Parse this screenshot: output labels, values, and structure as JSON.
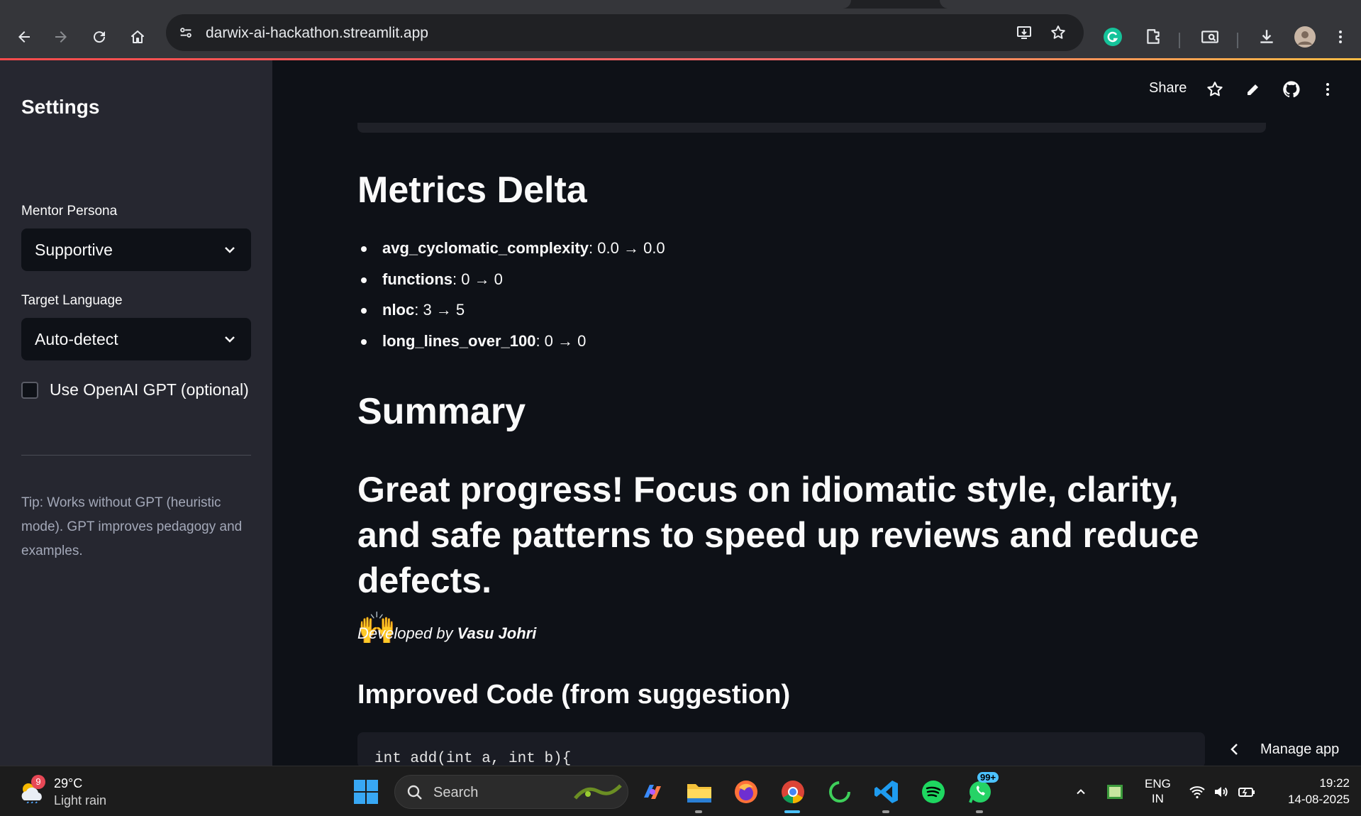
{
  "browser": {
    "url": "darwix-ai-hackathon.streamlit.app"
  },
  "header": {
    "share_label": "Share"
  },
  "sidebar": {
    "title": "Settings",
    "persona_label": "Mentor Persona",
    "persona_value": "Supportive",
    "language_label": "Target Language",
    "language_value": "Auto-detect",
    "gpt_checkbox_label": "Use OpenAI GPT (optional)",
    "gpt_checked": false,
    "tip": "Tip: Works without GPT (heuristic mode). GPT improves pedagogy and examples."
  },
  "main": {
    "metrics_title": "Metrics Delta",
    "metrics": [
      {
        "key": "avg_cyclomatic_complexity",
        "value": ": 0.0 → 0.0"
      },
      {
        "key": "functions",
        "value": ": 0 → 0"
      },
      {
        "key": "nloc",
        "value": ": 3 → 5"
      },
      {
        "key": "long_lines_over_100",
        "value": ": 0 → 0"
      }
    ],
    "summary_title": "Summary",
    "summary_text": "Great progress! Focus on idiomatic style, clarity, and safe patterns to speed up reviews and reduce defects.",
    "summary_emoji": "🙌",
    "dev_prefix": "Developed by ",
    "dev_name": "Vasu Johri",
    "code_title": "Improved Code (from suggestion)",
    "code_first_line": "int add(int a, int b){",
    "manage_app_label": "Manage app"
  },
  "taskbar": {
    "weather_temp": "29°C",
    "weather_condition": "Light rain",
    "weather_badge": "9",
    "search_label": "Search",
    "whatsapp_badge": "99+",
    "lang_line1": "ENG",
    "lang_line2": "IN",
    "time": "19:22",
    "date": "14-08-2025"
  },
  "colors": {
    "app_bg": "#0e1117",
    "sidebar_bg": "#262730",
    "accent_red": "#ff4b4b"
  }
}
